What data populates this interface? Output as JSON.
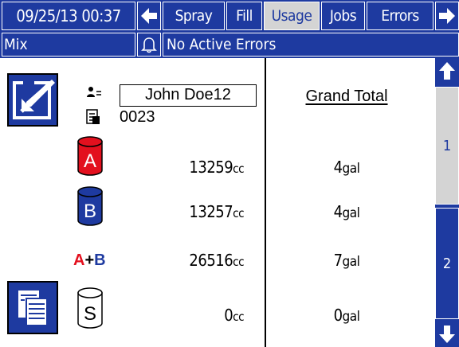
{
  "header": {
    "datetime": "09/25/13 00:37",
    "tabs": [
      {
        "label": "Spray"
      },
      {
        "label": "Fill"
      },
      {
        "label": "Usage"
      },
      {
        "label": "Jobs"
      },
      {
        "label": "Errors"
      }
    ],
    "active_tab": "Usage"
  },
  "status": {
    "mode": "Mix",
    "errors": "No Active Errors"
  },
  "job": {
    "user": "John Doe12",
    "job_number": "0023"
  },
  "usage": {
    "grand_total_label": "Grand Total",
    "rows": [
      {
        "id": "A",
        "label": "A",
        "job_value": "13259",
        "job_unit": "cc",
        "total_value": "4",
        "total_unit": "gal",
        "color": "#e3101e"
      },
      {
        "id": "B",
        "label": "B",
        "job_value": "13257",
        "job_unit": "cc",
        "total_value": "4",
        "total_unit": "gal",
        "color": "#1e3aa0"
      },
      {
        "id": "AB",
        "label_a": "A",
        "label_plus": "+",
        "label_b": "B",
        "job_value": "26516",
        "job_unit": "cc",
        "total_value": "7",
        "total_unit": "gal"
      },
      {
        "id": "S",
        "label": "S",
        "job_value": "0",
        "job_unit": "cc",
        "total_value": "0",
        "total_unit": "gal",
        "color": "#ffffff"
      }
    ]
  },
  "pager": {
    "pages": [
      "1",
      "2"
    ],
    "active_page": "1"
  },
  "colors": {
    "brand_blue": "#1e3aa0",
    "component_a_red": "#e3101e",
    "active_tab_gray": "#d4d4d4"
  },
  "icons": {
    "back": "arrow-left-icon",
    "forward": "arrow-right-icon",
    "alarm": "bell-icon",
    "edit": "edit-pencil-icon",
    "user": "user-id-icon",
    "job": "job-document-icon",
    "report": "report-pages-icon",
    "scroll_up": "arrow-up-icon",
    "scroll_down": "arrow-down-icon"
  }
}
